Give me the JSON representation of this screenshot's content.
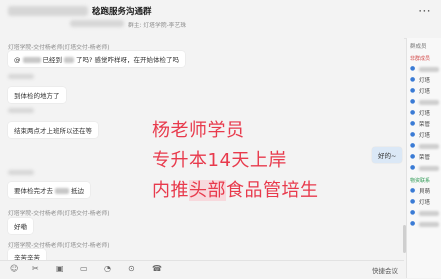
{
  "header": {
    "group_name": "稔跑服务沟通群",
    "subtitle": "群主: 灯塔学院-李艺珠",
    "more_icon": "⋯"
  },
  "messages": [
    {
      "sender": "灯塔学院-交付杨老师(灯塔交付-杨老师)",
      "parts": [
        "@",
        "已经到",
        "了吗? 感觉咋样呀，在开始体检了吗"
      ]
    },
    {
      "text": "到体检的地方了"
    },
    {
      "text": "结束两点才上班所以还在等"
    },
    {
      "text": "好的~"
    },
    {
      "text": "要体检完才去",
      "tail": "抵边"
    },
    {
      "sender": "灯塔学院-交付杨老师(灯塔交付-杨老师)",
      "text": "好嘞"
    },
    {
      "sender": "灯塔学院-交付杨老师(灯塔交付-杨老师)",
      "text": "辛苦辛苦"
    }
  ],
  "overlay": {
    "line1": "杨老师学员",
    "line2": "专升本14天上岸",
    "line3_pre": "内推",
    "line3_hl": "头部",
    "line3_post": "食品管培生"
  },
  "sidebar": {
    "title": "群成员",
    "section1": "非群成员",
    "section2": "物资联系",
    "members": [
      "",
      "灯塔",
      "灯塔",
      "",
      "灯塔",
      "荣管",
      "灯塔",
      "",
      "荣管",
      "",
      "貝萌",
      "灯塔",
      "",
      ""
    ]
  },
  "toolbar": {
    "emoji_icon": "☺",
    "scissors_icon": "✂",
    "image_icon": "▣",
    "folder_icon": "▭",
    "chat_icon": "◔",
    "mic_icon": "⊙",
    "phone_icon": "☎",
    "quick_meeting": "快捷会议"
  }
}
